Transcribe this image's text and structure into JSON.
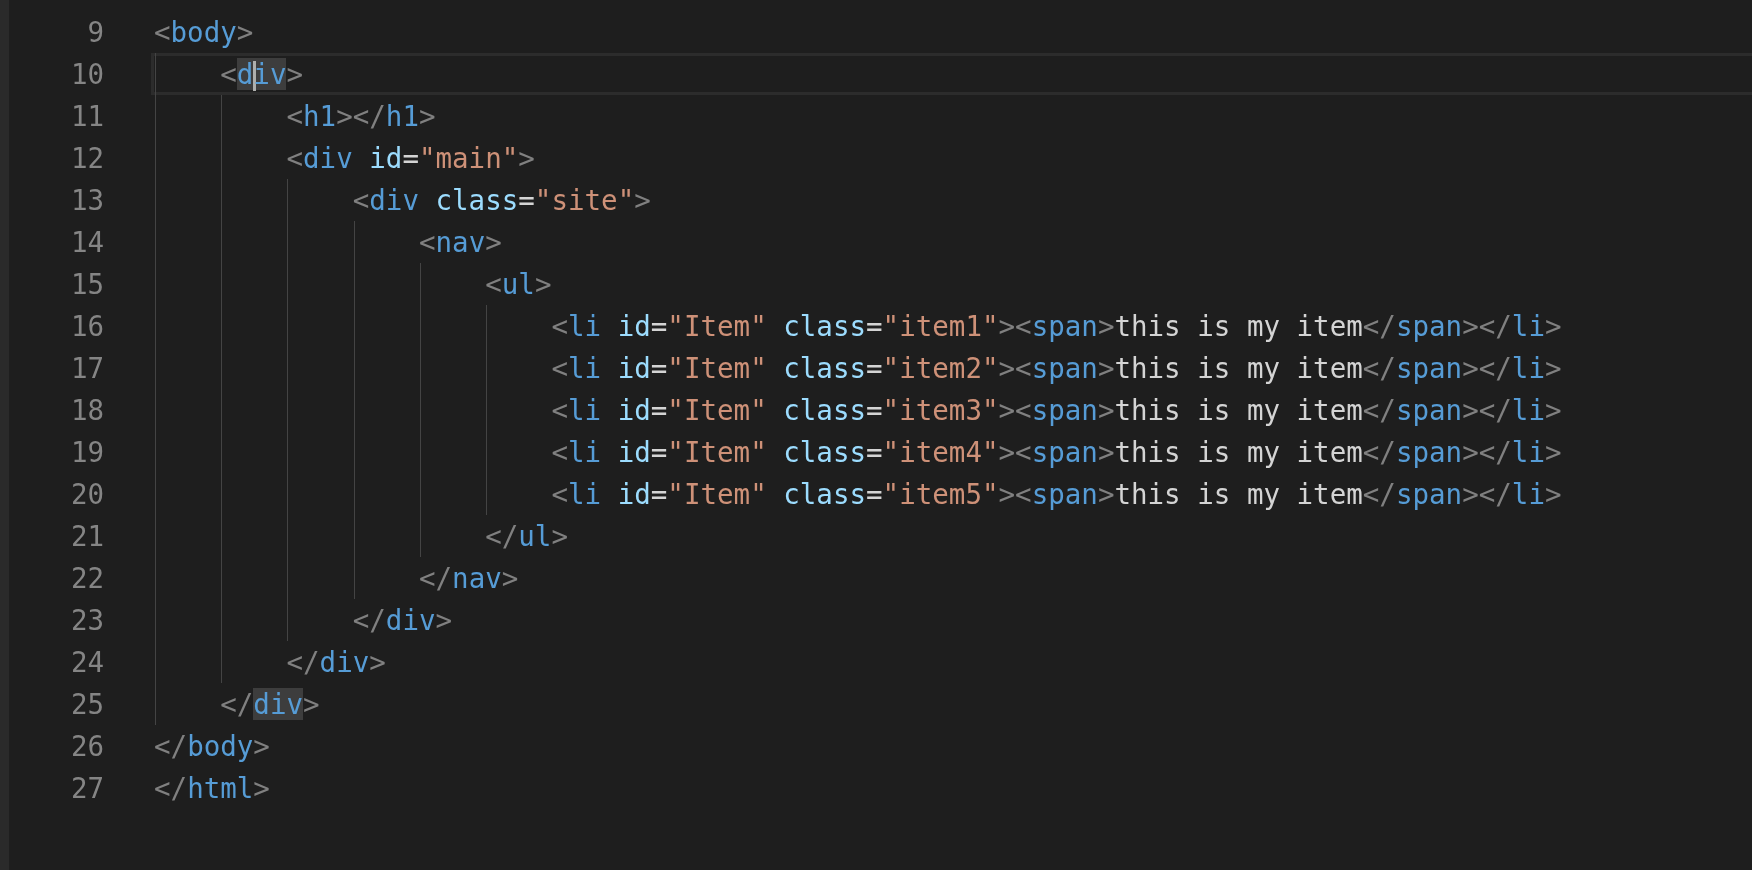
{
  "editor": {
    "lines": [
      {
        "number": "9",
        "selected": false,
        "tokens": [
          {
            "kind": "punct",
            "t": "<"
          },
          {
            "kind": "tag",
            "t": "body"
          },
          {
            "kind": "punct",
            "t": ">"
          }
        ],
        "children": [
          {
            "number": "10",
            "selected": true,
            "tokens": [
              {
                "kind": "punct",
                "t": "<"
              },
              {
                "kind": "tag",
                "t": "d",
                "matched": true
              },
              {
                "kind": "tag",
                "t": "iv",
                "matched": true,
                "cursor": true
              },
              {
                "kind": "punct",
                "t": ">"
              }
            ],
            "children": [
              {
                "number": "11",
                "selected": false,
                "tokens": [
                  {
                    "kind": "punct",
                    "t": "<"
                  },
                  {
                    "kind": "tag",
                    "t": "h1"
                  },
                  {
                    "kind": "punct",
                    "t": "></"
                  },
                  {
                    "kind": "tag",
                    "t": "h1"
                  },
                  {
                    "kind": "punct",
                    "t": ">"
                  }
                ]
              },
              {
                "number": "12",
                "selected": false,
                "tokens": [
                  {
                    "kind": "punct",
                    "t": "<"
                  },
                  {
                    "kind": "tag",
                    "t": "div"
                  },
                  {
                    "kind": "attr",
                    "t": " id"
                  },
                  {
                    "kind": "eq",
                    "t": "="
                  },
                  {
                    "kind": "str",
                    "t": "\"main\""
                  },
                  {
                    "kind": "punct",
                    "t": ">"
                  }
                ],
                "children": [
                  {
                    "number": "13",
                    "selected": false,
                    "tokens": [
                      {
                        "kind": "punct",
                        "t": "<"
                      },
                      {
                        "kind": "tag",
                        "t": "div"
                      },
                      {
                        "kind": "attr",
                        "t": " class"
                      },
                      {
                        "kind": "eq",
                        "t": "="
                      },
                      {
                        "kind": "str",
                        "t": "\"site\""
                      },
                      {
                        "kind": "punct",
                        "t": ">"
                      }
                    ],
                    "children": [
                      {
                        "number": "14",
                        "selected": false,
                        "tokens": [
                          {
                            "kind": "punct",
                            "t": "<"
                          },
                          {
                            "kind": "tag",
                            "t": "nav"
                          },
                          {
                            "kind": "punct",
                            "t": ">"
                          }
                        ],
                        "children": [
                          {
                            "number": "15",
                            "selected": false,
                            "tokens": [
                              {
                                "kind": "punct",
                                "t": "<"
                              },
                              {
                                "kind": "tag",
                                "t": "ul"
                              },
                              {
                                "kind": "punct",
                                "t": ">"
                              }
                            ],
                            "children": [
                              {
                                "number": "16",
                                "selected": false,
                                "tokens": [
                                  {
                                    "kind": "punct",
                                    "t": "<"
                                  },
                                  {
                                    "kind": "tag",
                                    "t": "li"
                                  },
                                  {
                                    "kind": "attr",
                                    "t": " id"
                                  },
                                  {
                                    "kind": "eq",
                                    "t": "="
                                  },
                                  {
                                    "kind": "str",
                                    "t": "\"Item\""
                                  },
                                  {
                                    "kind": "attr",
                                    "t": " class"
                                  },
                                  {
                                    "kind": "eq",
                                    "t": "="
                                  },
                                  {
                                    "kind": "str",
                                    "t": "\"item1\""
                                  },
                                  {
                                    "kind": "punct",
                                    "t": "><"
                                  },
                                  {
                                    "kind": "tag",
                                    "t": "span"
                                  },
                                  {
                                    "kind": "punct",
                                    "t": ">"
                                  },
                                  {
                                    "kind": "text",
                                    "t": "this is my item"
                                  },
                                  {
                                    "kind": "punct",
                                    "t": "</"
                                  },
                                  {
                                    "kind": "tag",
                                    "t": "span"
                                  },
                                  {
                                    "kind": "punct",
                                    "t": "></"
                                  },
                                  {
                                    "kind": "tag",
                                    "t": "li"
                                  },
                                  {
                                    "kind": "punct",
                                    "t": ">"
                                  }
                                ]
                              },
                              {
                                "number": "17",
                                "selected": false,
                                "tokens": [
                                  {
                                    "kind": "punct",
                                    "t": "<"
                                  },
                                  {
                                    "kind": "tag",
                                    "t": "li"
                                  },
                                  {
                                    "kind": "attr",
                                    "t": " id"
                                  },
                                  {
                                    "kind": "eq",
                                    "t": "="
                                  },
                                  {
                                    "kind": "str",
                                    "t": "\"Item\""
                                  },
                                  {
                                    "kind": "attr",
                                    "t": " class"
                                  },
                                  {
                                    "kind": "eq",
                                    "t": "="
                                  },
                                  {
                                    "kind": "str",
                                    "t": "\"item2\""
                                  },
                                  {
                                    "kind": "punct",
                                    "t": "><"
                                  },
                                  {
                                    "kind": "tag",
                                    "t": "span"
                                  },
                                  {
                                    "kind": "punct",
                                    "t": ">"
                                  },
                                  {
                                    "kind": "text",
                                    "t": "this is my item"
                                  },
                                  {
                                    "kind": "punct",
                                    "t": "</"
                                  },
                                  {
                                    "kind": "tag",
                                    "t": "span"
                                  },
                                  {
                                    "kind": "punct",
                                    "t": "></"
                                  },
                                  {
                                    "kind": "tag",
                                    "t": "li"
                                  },
                                  {
                                    "kind": "punct",
                                    "t": ">"
                                  }
                                ]
                              },
                              {
                                "number": "18",
                                "selected": false,
                                "tokens": [
                                  {
                                    "kind": "punct",
                                    "t": "<"
                                  },
                                  {
                                    "kind": "tag",
                                    "t": "li"
                                  },
                                  {
                                    "kind": "attr",
                                    "t": " id"
                                  },
                                  {
                                    "kind": "eq",
                                    "t": "="
                                  },
                                  {
                                    "kind": "str",
                                    "t": "\"Item\""
                                  },
                                  {
                                    "kind": "attr",
                                    "t": " class"
                                  },
                                  {
                                    "kind": "eq",
                                    "t": "="
                                  },
                                  {
                                    "kind": "str",
                                    "t": "\"item3\""
                                  },
                                  {
                                    "kind": "punct",
                                    "t": "><"
                                  },
                                  {
                                    "kind": "tag",
                                    "t": "span"
                                  },
                                  {
                                    "kind": "punct",
                                    "t": ">"
                                  },
                                  {
                                    "kind": "text",
                                    "t": "this is my item"
                                  },
                                  {
                                    "kind": "punct",
                                    "t": "</"
                                  },
                                  {
                                    "kind": "tag",
                                    "t": "span"
                                  },
                                  {
                                    "kind": "punct",
                                    "t": "></"
                                  },
                                  {
                                    "kind": "tag",
                                    "t": "li"
                                  },
                                  {
                                    "kind": "punct",
                                    "t": ">"
                                  }
                                ]
                              },
                              {
                                "number": "19",
                                "selected": false,
                                "tokens": [
                                  {
                                    "kind": "punct",
                                    "t": "<"
                                  },
                                  {
                                    "kind": "tag",
                                    "t": "li"
                                  },
                                  {
                                    "kind": "attr",
                                    "t": " id"
                                  },
                                  {
                                    "kind": "eq",
                                    "t": "="
                                  },
                                  {
                                    "kind": "str",
                                    "t": "\"Item\""
                                  },
                                  {
                                    "kind": "attr",
                                    "t": " class"
                                  },
                                  {
                                    "kind": "eq",
                                    "t": "="
                                  },
                                  {
                                    "kind": "str",
                                    "t": "\"item4\""
                                  },
                                  {
                                    "kind": "punct",
                                    "t": "><"
                                  },
                                  {
                                    "kind": "tag",
                                    "t": "span"
                                  },
                                  {
                                    "kind": "punct",
                                    "t": ">"
                                  },
                                  {
                                    "kind": "text",
                                    "t": "this is my item"
                                  },
                                  {
                                    "kind": "punct",
                                    "t": "</"
                                  },
                                  {
                                    "kind": "tag",
                                    "t": "span"
                                  },
                                  {
                                    "kind": "punct",
                                    "t": "></"
                                  },
                                  {
                                    "kind": "tag",
                                    "t": "li"
                                  },
                                  {
                                    "kind": "punct",
                                    "t": ">"
                                  }
                                ]
                              },
                              {
                                "number": "20",
                                "selected": false,
                                "tokens": [
                                  {
                                    "kind": "punct",
                                    "t": "<"
                                  },
                                  {
                                    "kind": "tag",
                                    "t": "li"
                                  },
                                  {
                                    "kind": "attr",
                                    "t": " id"
                                  },
                                  {
                                    "kind": "eq",
                                    "t": "="
                                  },
                                  {
                                    "kind": "str",
                                    "t": "\"Item\""
                                  },
                                  {
                                    "kind": "attr",
                                    "t": " class"
                                  },
                                  {
                                    "kind": "eq",
                                    "t": "="
                                  },
                                  {
                                    "kind": "str",
                                    "t": "\"item5\""
                                  },
                                  {
                                    "kind": "punct",
                                    "t": "><"
                                  },
                                  {
                                    "kind": "tag",
                                    "t": "span"
                                  },
                                  {
                                    "kind": "punct",
                                    "t": ">"
                                  },
                                  {
                                    "kind": "text",
                                    "t": "this is my item"
                                  },
                                  {
                                    "kind": "punct",
                                    "t": "</"
                                  },
                                  {
                                    "kind": "tag",
                                    "t": "span"
                                  },
                                  {
                                    "kind": "punct",
                                    "t": "></"
                                  },
                                  {
                                    "kind": "tag",
                                    "t": "li"
                                  },
                                  {
                                    "kind": "punct",
                                    "t": ">"
                                  }
                                ]
                              }
                            ]
                          },
                          {
                            "number": "21",
                            "selected": false,
                            "tokens": [
                              {
                                "kind": "punct",
                                "t": "</"
                              },
                              {
                                "kind": "tag",
                                "t": "ul"
                              },
                              {
                                "kind": "punct",
                                "t": ">"
                              }
                            ]
                          }
                        ]
                      },
                      {
                        "number": "22",
                        "selected": false,
                        "tokens": [
                          {
                            "kind": "punct",
                            "t": "</"
                          },
                          {
                            "kind": "tag",
                            "t": "nav"
                          },
                          {
                            "kind": "punct",
                            "t": ">"
                          }
                        ]
                      }
                    ]
                  },
                  {
                    "number": "23",
                    "selected": false,
                    "tokens": [
                      {
                        "kind": "punct",
                        "t": "</"
                      },
                      {
                        "kind": "tag",
                        "t": "div"
                      },
                      {
                        "kind": "punct",
                        "t": ">"
                      }
                    ]
                  }
                ]
              },
              {
                "number": "24",
                "selected": false,
                "tokens": [
                  {
                    "kind": "punct",
                    "t": "</"
                  },
                  {
                    "kind": "tag",
                    "t": "div"
                  },
                  {
                    "kind": "punct",
                    "t": ">"
                  }
                ]
              }
            ]
          },
          {
            "number": "25",
            "selected": false,
            "tokens": [
              {
                "kind": "punct",
                "t": "</"
              },
              {
                "kind": "tag",
                "t": "div",
                "matched": true
              },
              {
                "kind": "punct",
                "t": ">"
              }
            ]
          }
        ]
      },
      {
        "number": "26",
        "selected": false,
        "tokens": [
          {
            "kind": "punct",
            "t": "</"
          },
          {
            "kind": "tag",
            "t": "body"
          },
          {
            "kind": "punct",
            "t": ">"
          }
        ]
      },
      {
        "number": "27",
        "selected": false,
        "tokens": [
          {
            "kind": "punct",
            "t": "</"
          },
          {
            "kind": "tag",
            "t": "html"
          },
          {
            "kind": "punct",
            "t": ">"
          }
        ]
      }
    ]
  }
}
